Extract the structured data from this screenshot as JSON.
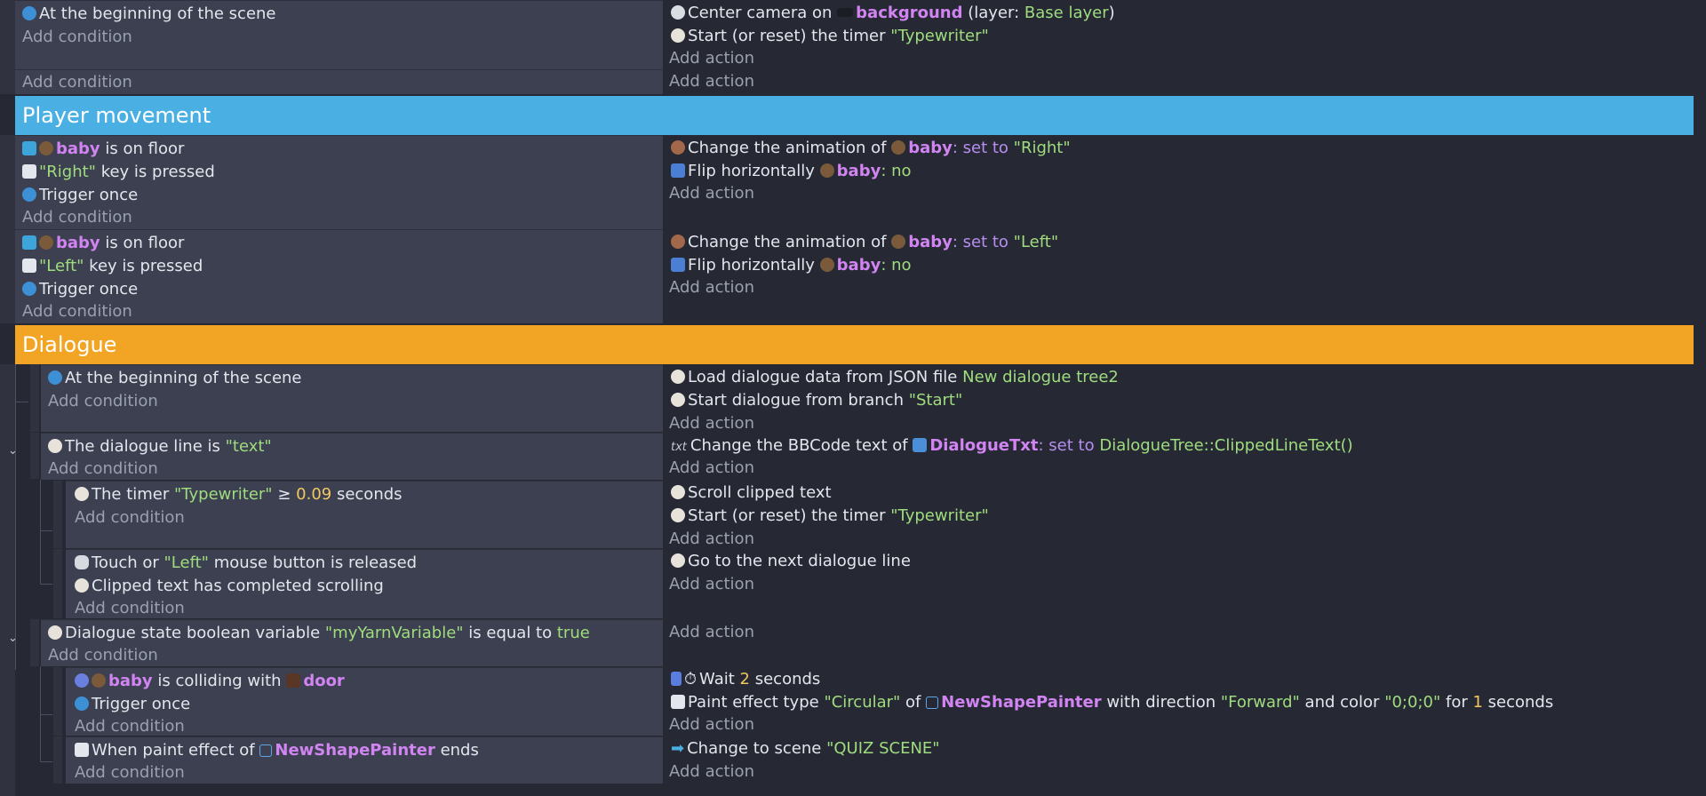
{
  "colors": {
    "background": "#262934",
    "condition_bg": "#3c4050",
    "object": "#d184f2",
    "string": "#9fdc7e",
    "number": "#f0c860",
    "keyword": "#b78ef0",
    "group_player": "#4ab0e4",
    "group_dialogue": "#f2a424"
  },
  "common": {
    "add_condition": "Add condition",
    "add_action": "Add action"
  },
  "groups": {
    "player": "Player movement",
    "dialogue": "Dialogue"
  },
  "e1": {
    "cond1": "At the beginning of the scene",
    "a1_pre": "Center camera on",
    "a1_obj": "background",
    "a1_mid": "(layer:",
    "a1_layer": "Base layer",
    "a1_post": ")",
    "a2_pre": "Start (or reset) the timer",
    "a2_str": "\"Typewriter\""
  },
  "e2": {
    "c1_obj": "baby",
    "c1_post": "is on floor",
    "c2_str": "\"Right\"",
    "c2_post": "key is pressed",
    "c3": "Trigger once",
    "a1_pre": "Change the animation of",
    "a1_obj": "baby",
    "a1_kw": ": set to",
    "a1_str": "\"Right\"",
    "a2_pre": "Flip horizontally",
    "a2_obj": "baby",
    "a2_kw": ": no"
  },
  "e3": {
    "c1_obj": "baby",
    "c1_post": "is on floor",
    "c2_str": "\"Left\"",
    "c2_post": "key is pressed",
    "c3": "Trigger once",
    "a1_pre": "Change the animation of",
    "a1_obj": "baby",
    "a1_kw": ": set to",
    "a1_str": "\"Left\"",
    "a2_pre": "Flip horizontally",
    "a2_obj": "baby",
    "a2_kw": ": no"
  },
  "e4": {
    "c1": "At the beginning of the scene",
    "a1_pre": "Load dialogue data from JSON file",
    "a1_str": "New dialogue tree2",
    "a2_pre": "Start dialogue from branch",
    "a2_str": "\"Start\""
  },
  "e5": {
    "c1_pre": "The dialogue line is",
    "c1_str": "\"text\"",
    "a1_pre": "Change the BBCode text of",
    "a1_obj": "DialogueTxt",
    "a1_kw": ": set to",
    "a1_str": "DialogueTree::ClippedLineText()"
  },
  "e6": {
    "c1_pre": "The timer",
    "c1_str": "\"Typewriter\"",
    "c1_op": "≥",
    "c1_num": "0.09",
    "c1_post": "seconds",
    "a1": "Scroll clipped text",
    "a2_pre": "Start (or reset) the timer",
    "a2_str": "\"Typewriter\""
  },
  "e7": {
    "c1_pre": "Touch or",
    "c1_str": "\"Left\"",
    "c1_post": "mouse button is released",
    "c2": "Clipped text has completed scrolling",
    "a1": "Go to the next dialogue line"
  },
  "e8": {
    "c1_pre": "Dialogue state boolean variable",
    "c1_str": "\"myYarnVariable\"",
    "c1_mid": "is equal to",
    "c1_val": "true"
  },
  "e9": {
    "c1_obj": "baby",
    "c1_mid": "is colliding with",
    "c1_obj2": "door",
    "c2": "Trigger once",
    "a1_pre": "Wait",
    "a1_num": "2",
    "a1_post": "seconds",
    "a2_pre": "Paint effect type",
    "a2_str": "\"Circular\"",
    "a2_of": "of",
    "a2_obj": "NewShapePainter",
    "a2_dir": "with direction",
    "a2_dirv": "\"Forward\"",
    "a2_col": "and color",
    "a2_colv": "\"0;0;0\"",
    "a2_for": "for",
    "a2_num": "1",
    "a2_sec": "seconds"
  },
  "e10": {
    "c1_pre": "When paint effect of",
    "c1_obj": "NewShapePainter",
    "c1_post": "ends",
    "a1_pre": "Change to scene",
    "a1_str": "\"QUIZ SCENE\""
  }
}
